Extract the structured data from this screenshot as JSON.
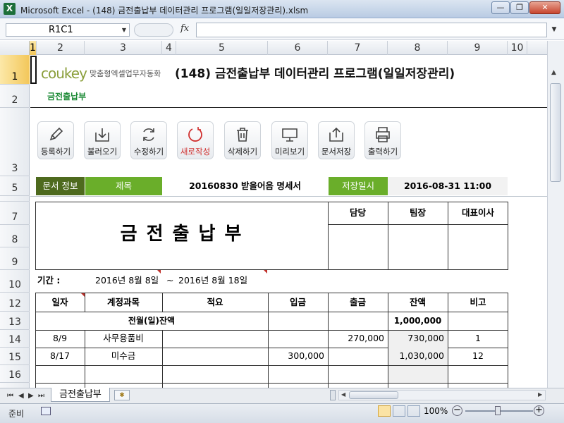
{
  "window": {
    "title": "Microsoft Excel - (148) 금전출납부 데이터관리 프로그램(일일저장관리).xlsm",
    "app_icon": "X",
    "min_label": "—",
    "max_label": "❐",
    "close_label": "✕"
  },
  "formula_bar": {
    "name_box": "R1C1",
    "fx_label": "fx",
    "formula": ""
  },
  "columns": [
    "1",
    "2",
    "3",
    "4",
    "5",
    "6",
    "7",
    "8",
    "9",
    "10"
  ],
  "rows": [
    "1",
    "2",
    "3",
    "5",
    "7",
    "8",
    "9",
    "10",
    "12",
    "13",
    "14",
    "15",
    "16"
  ],
  "header": {
    "brand": "coukey",
    "brand_sub": "맞춤형엑셀업무자동화",
    "app_title": "(148) 금전출납부 데이터관리 프로그램(일일저장관리)",
    "sheet_label": "금전출납부"
  },
  "toolbar": [
    {
      "label": "등록하기",
      "icon": "pencil-icon"
    },
    {
      "label": "불러오기",
      "icon": "download-tray-icon"
    },
    {
      "label": "수정하기",
      "icon": "refresh-icon"
    },
    {
      "label": "새로작성",
      "icon": "new-circle-icon"
    },
    {
      "label": "삭제하기",
      "icon": "trash-icon"
    },
    {
      "label": "미리보기",
      "icon": "monitor-icon"
    },
    {
      "label": "문서저장",
      "icon": "upload-tray-icon"
    },
    {
      "label": "출력하기",
      "icon": "printer-icon"
    }
  ],
  "info": {
    "doc_info_label": "문서 정보",
    "title_label": "제목",
    "title_value": "20160830 받을어음 명세서",
    "saved_label": "저장일시",
    "saved_value": "2016-08-31 11:00"
  },
  "form": {
    "big_title": "금 전 출 납 부",
    "approvals": [
      "담당",
      "팀장",
      "대표이사"
    ],
    "period_label": "기간 :",
    "period_from": "2016년 8월 8일",
    "period_sep": "~",
    "period_to": "2016년 8월 18일"
  },
  "table": {
    "headers": [
      "일자",
      "계정과목",
      "적요",
      "입금",
      "출금",
      "잔액",
      "비고"
    ],
    "carry_label": "전월(일)잔액",
    "carry_balance": "1,000,000",
    "rows": [
      {
        "date": "8/9",
        "account": "사무용품비",
        "memo": "",
        "in": "",
        "out": "270,000",
        "balance": "730,000",
        "note": "1"
      },
      {
        "date": "8/17",
        "account": "미수금",
        "memo": "",
        "in": "300,000",
        "out": "",
        "balance": "1,030,000",
        "note": "12"
      }
    ]
  },
  "tabs": {
    "sheet_tab": "금전출납부"
  },
  "status": {
    "ready": "준비",
    "zoom": "100%"
  },
  "colors": {
    "accent_green": "#1b8a35",
    "info_dark": "#4e6a1e",
    "info_green": "#6aae2a"
  }
}
